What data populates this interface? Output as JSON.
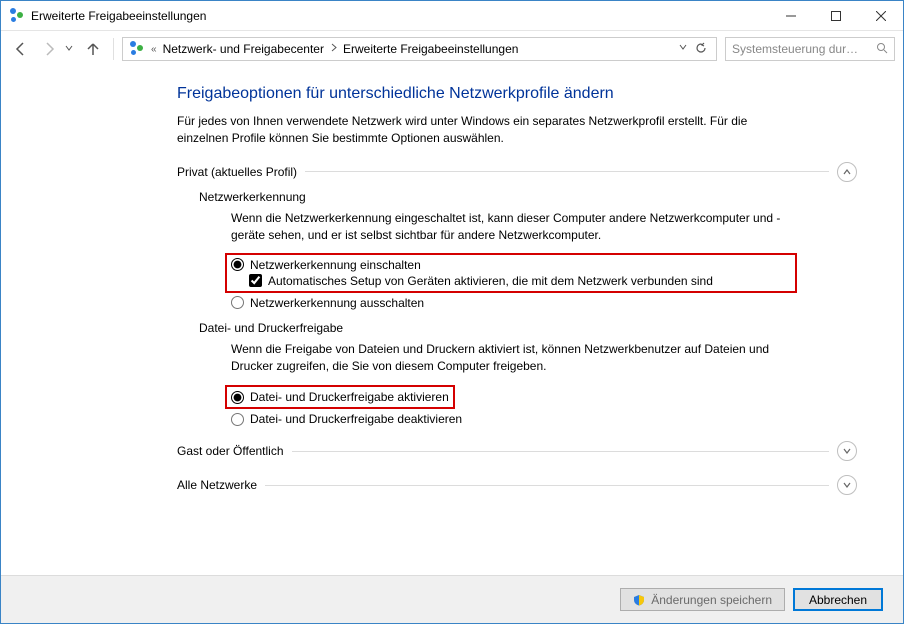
{
  "window": {
    "title": "Erweiterte Freigabeeinstellungen"
  },
  "breadcrumb": {
    "overflow": "«",
    "segments": [
      "Netzwerk- und Freigabecenter",
      "Erweiterte Freigabeeinstellungen"
    ]
  },
  "search": {
    "placeholder": "Systemsteuerung dur…",
    "icon": "search-icon"
  },
  "heading": "Freigabeoptionen für unterschiedliche Netzwerkprofile ändern",
  "intro": "Für jedes von Ihnen verwendete Netzwerk wird unter Windows ein separates Netzwerkprofil erstellt. Für die einzelnen Profile können Sie bestimmte Optionen auswählen.",
  "profiles": {
    "private": {
      "label": "Privat (aktuelles Profil)",
      "expanded": true,
      "network_discovery": {
        "title": "Netzwerkerkennung",
        "desc": "Wenn die Netzwerkerkennung eingeschaltet ist, kann dieser Computer andere Netzwerkcomputer und -geräte sehen, und er ist selbst sichtbar für andere Netzwerkcomputer.",
        "opt_on": "Netzwerkerkennung einschalten",
        "opt_on_selected": true,
        "opt_auto": "Automatisches Setup von Geräten aktivieren, die mit dem Netzwerk verbunden sind",
        "opt_auto_checked": true,
        "opt_off": "Netzwerkerkennung ausschalten",
        "opt_off_selected": false
      },
      "file_printer": {
        "title": "Datei- und Druckerfreigabe",
        "desc": "Wenn die Freigabe von Dateien und Druckern aktiviert ist, können Netzwerkbenutzer auf Dateien und Drucker zugreifen, die Sie von diesem Computer freigeben.",
        "opt_on": "Datei- und Druckerfreigabe aktivieren",
        "opt_on_selected": true,
        "opt_off": "Datei- und Druckerfreigabe deaktivieren",
        "opt_off_selected": false
      }
    },
    "guest": {
      "label": "Gast oder Öffentlich",
      "expanded": false
    },
    "all": {
      "label": "Alle Netzwerke",
      "expanded": false
    }
  },
  "footer": {
    "save": "Änderungen speichern",
    "cancel": "Abbrechen"
  }
}
